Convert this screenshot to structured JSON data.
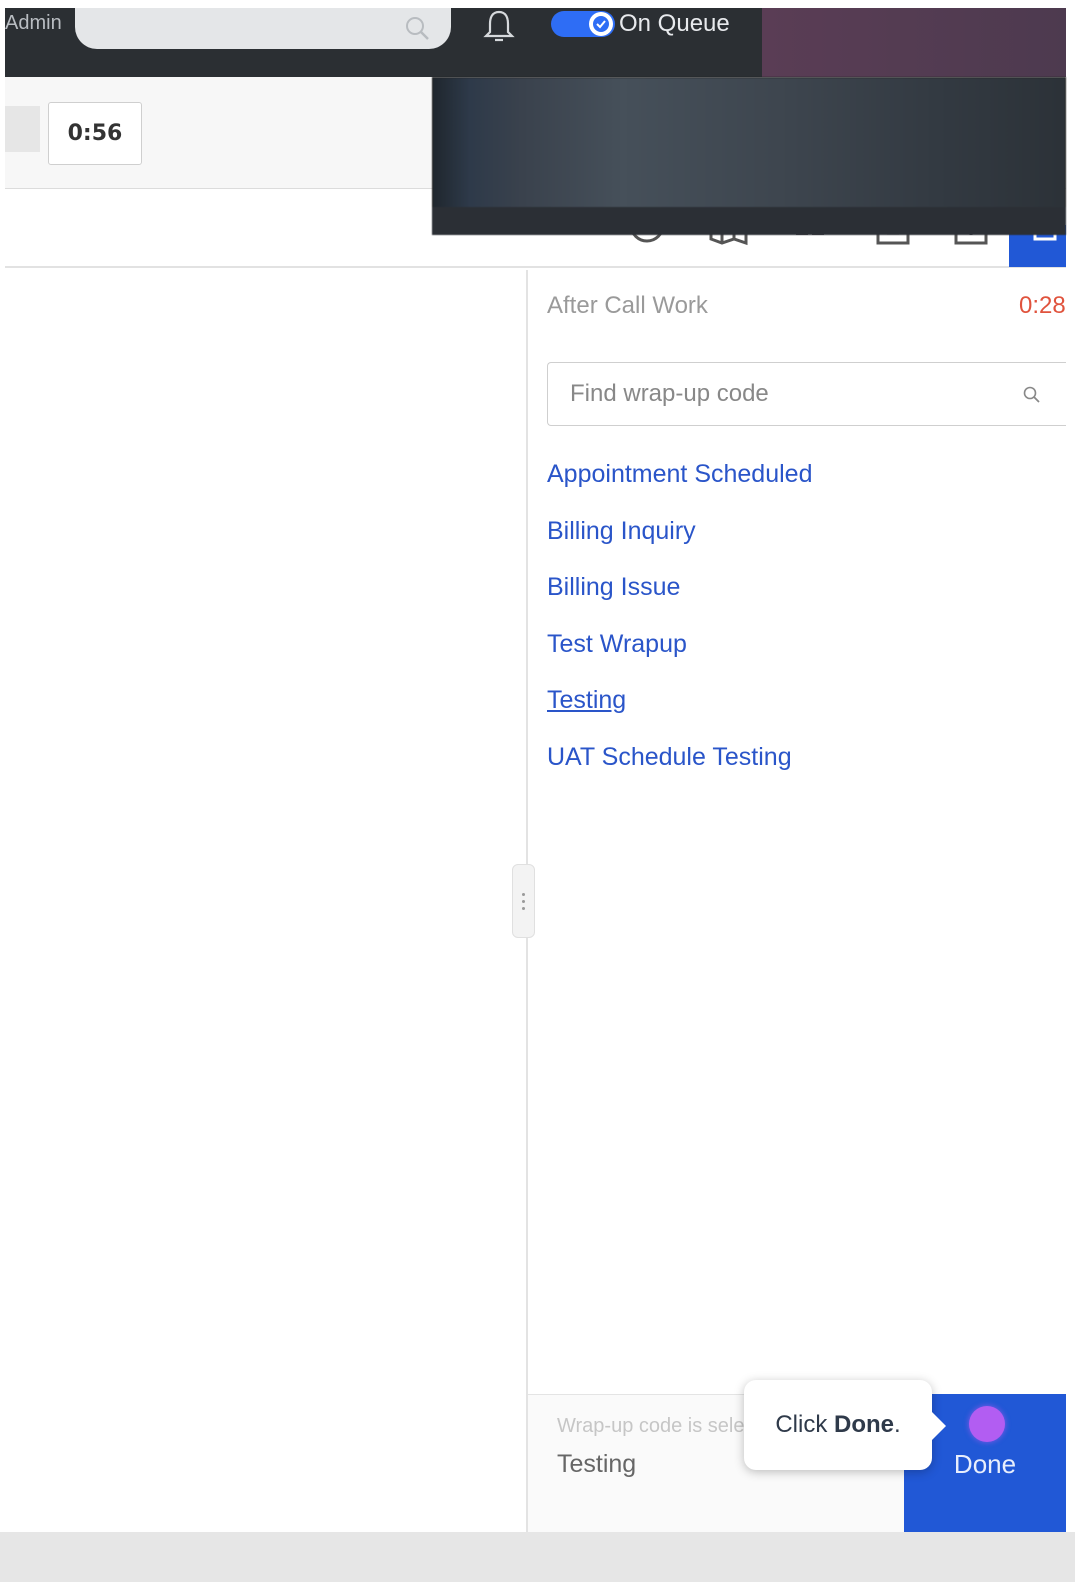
{
  "header": {
    "admin_label": "Admin",
    "queue_status": "On Queue"
  },
  "call": {
    "timer": "0:56"
  },
  "wrapup": {
    "heading": "After Call Work",
    "timer": "0:28",
    "search_placeholder": "Find wrap-up code",
    "codes": [
      "Appointment Scheduled",
      "Billing Inquiry",
      "Billing Issue",
      "Test Wrapup",
      "Testing",
      "UAT Schedule Testing"
    ],
    "selected_label": "Wrap-up code is selected",
    "selected_value": "Testing",
    "done_label": "Done"
  },
  "tooltip": {
    "prefix": "Click ",
    "bold": "Done",
    "suffix": "."
  },
  "colors": {
    "accent": "#2158d6",
    "link": "#2a55c9",
    "timer_red": "#e0533d",
    "highlight_dot": "#b25df2"
  }
}
